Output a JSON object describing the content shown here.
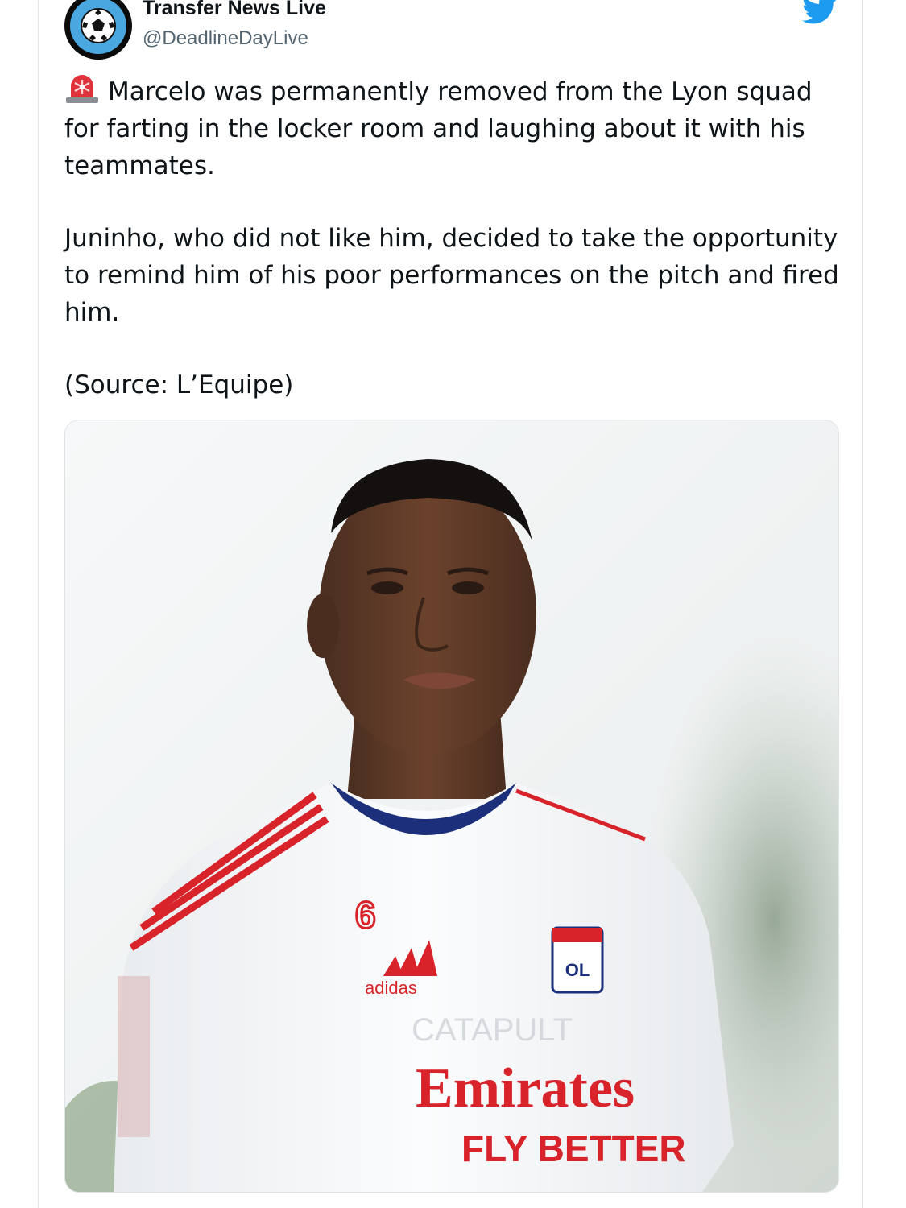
{
  "tweet": {
    "author": {
      "display_name": "Transfer News Live",
      "handle": "@DeadlineDayLive",
      "avatar_icon": "soccer-ball-icon"
    },
    "platform_icon": "twitter-bird-icon",
    "paragraphs": [
      {
        "emoji": "rotating-light-icon",
        "text": "Marcelo was permanently removed from the Lyon squad for farting in the locker room and laughing about it with his teammates."
      },
      {
        "text": "Juninho, who did not like him, decided to take the opportunity to remind him of his poor performances on the pitch and fired him."
      },
      {
        "text": "(Source: L’Equipe)"
      }
    ],
    "media": {
      "kit_number": "6",
      "kit_brand": "adidas",
      "club_crest_text": "OL",
      "sponsor_line1": "Emirates",
      "sponsor_line2": "FLY BETTER",
      "watermark": "CATAPULT"
    }
  },
  "colors": {
    "twitter_blue": "#1d9bf0",
    "text_primary": "#0f1419",
    "text_secondary": "#536471",
    "lyon_red": "#d8232a",
    "lyon_blue": "#1c2f7a"
  }
}
